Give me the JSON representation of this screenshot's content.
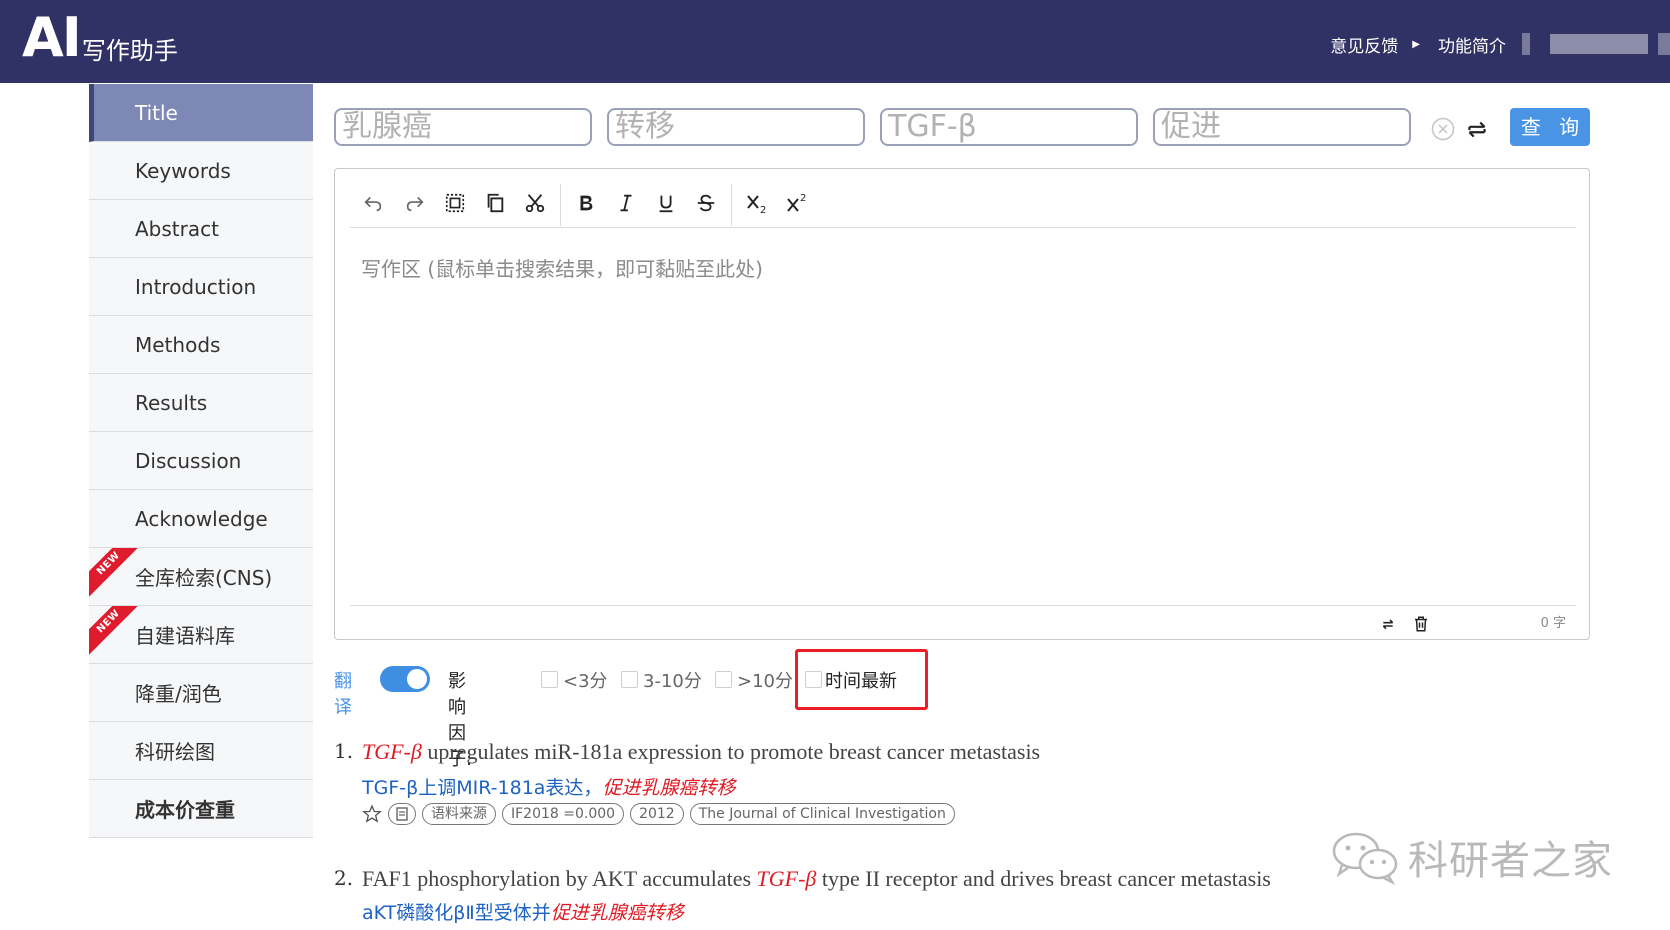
{
  "header": {
    "logo_ai": "AI",
    "logo_text": "写作助手",
    "nav": {
      "feedback": "意见反馈",
      "intro": "功能简介"
    }
  },
  "sidebar": {
    "items": [
      {
        "label": "Title",
        "active": true
      },
      {
        "label": "Keywords"
      },
      {
        "label": "Abstract"
      },
      {
        "label": "Introduction"
      },
      {
        "label": "Methods"
      },
      {
        "label": "Results"
      },
      {
        "label": "Discussion"
      },
      {
        "label": "Acknowledge"
      },
      {
        "label": "全库检索(CNS)",
        "badge": "NEW"
      },
      {
        "label": "自建语料库",
        "badge": "NEW"
      },
      {
        "label": "降重/润色"
      },
      {
        "label": "科研绘图"
      },
      {
        "label": "成本价查重",
        "bold": true
      }
    ]
  },
  "search": {
    "keywords": [
      "乳腺癌",
      "转移",
      "TGF-β",
      "促进"
    ],
    "query_label": "查 询"
  },
  "editor": {
    "placeholder": "写作区 (鼠标单击搜索结果，即可黏贴至此处)",
    "word_count": "0 字",
    "toolbar_icons": [
      "undo-icon",
      "redo-icon",
      "select-all-icon",
      "copy-icon",
      "cut-icon",
      "bold-icon",
      "italic-icon",
      "underline-icon",
      "strikethrough-icon",
      "subscript-icon",
      "superscript-icon"
    ]
  },
  "filters": {
    "translate_label": "翻译",
    "translate_on": true,
    "impact_label": "影响因子:",
    "options": [
      "<3分",
      "3-10分",
      ">10分"
    ],
    "latest_label": "时间最新"
  },
  "results": [
    {
      "num": "1.",
      "title_hl": "TGF-β",
      "title_rest": " upregulates miR-181a expression to promote breast cancer metastasis",
      "trans_main": "TGF-β上调MIR-181a表达，",
      "trans_hl": "促进乳腺癌转移",
      "tags": [
        "语料来源",
        "IF2018 =0.000",
        "2012",
        "The Journal of Clinical Investigation"
      ]
    },
    {
      "num": "2.",
      "title_pre": "FAF1 phosphorylation by AKT accumulates ",
      "title_hl": "TGF-β",
      "title_rest": " type II receptor and drives breast cancer metastasis",
      "trans_main": "aKT磷酸化βⅡ型受体并",
      "trans_hl": "促进乳腺癌转移"
    }
  ],
  "watermark": {
    "text": "科研者之家"
  },
  "colors": {
    "header_bg": "#303164",
    "sidebar_active": "#7d88b6",
    "accent_blue": "#4a94e6",
    "highlight_red": "#ee1d24"
  }
}
